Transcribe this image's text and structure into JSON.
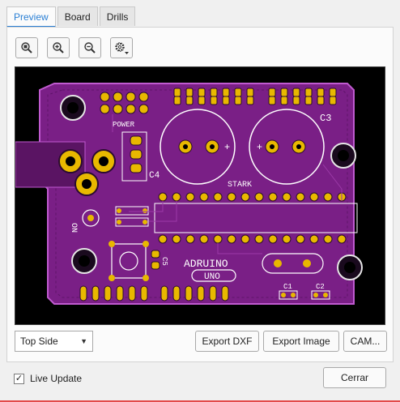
{
  "tabs": [
    {
      "label": "Preview",
      "active": true
    },
    {
      "label": "Board",
      "active": false
    },
    {
      "label": "Drills",
      "active": false
    }
  ],
  "toolbar": {
    "zoom_fit_icon": "zoom-fit-icon",
    "zoom_in_icon": "zoom-in-icon",
    "zoom_out_icon": "zoom-out-icon",
    "settings_icon": "gear-icon"
  },
  "board": {
    "power_label": "POWER",
    "c3_label": "C3",
    "c4_label": "C4",
    "stark_label": "STARK",
    "on_label": "ON",
    "c5_label": "C5",
    "arduino_label": "ADRUINO",
    "uno_label": "UNO",
    "c1_label": "C1",
    "c2_label": "C2",
    "colors": {
      "background": "#000000",
      "board": "#7a1f86",
      "board_edge": "#c05ad0",
      "pad": "#e8b800",
      "silk": "#ffffff"
    }
  },
  "side_select": {
    "value": "Top Side"
  },
  "buttons": {
    "export_dxf": "Export DXF",
    "export_image": "Export Image",
    "cam": "CAM..."
  },
  "footer": {
    "live_update_label": "Live Update",
    "live_update_checked": true,
    "close_label": "Cerrar"
  }
}
